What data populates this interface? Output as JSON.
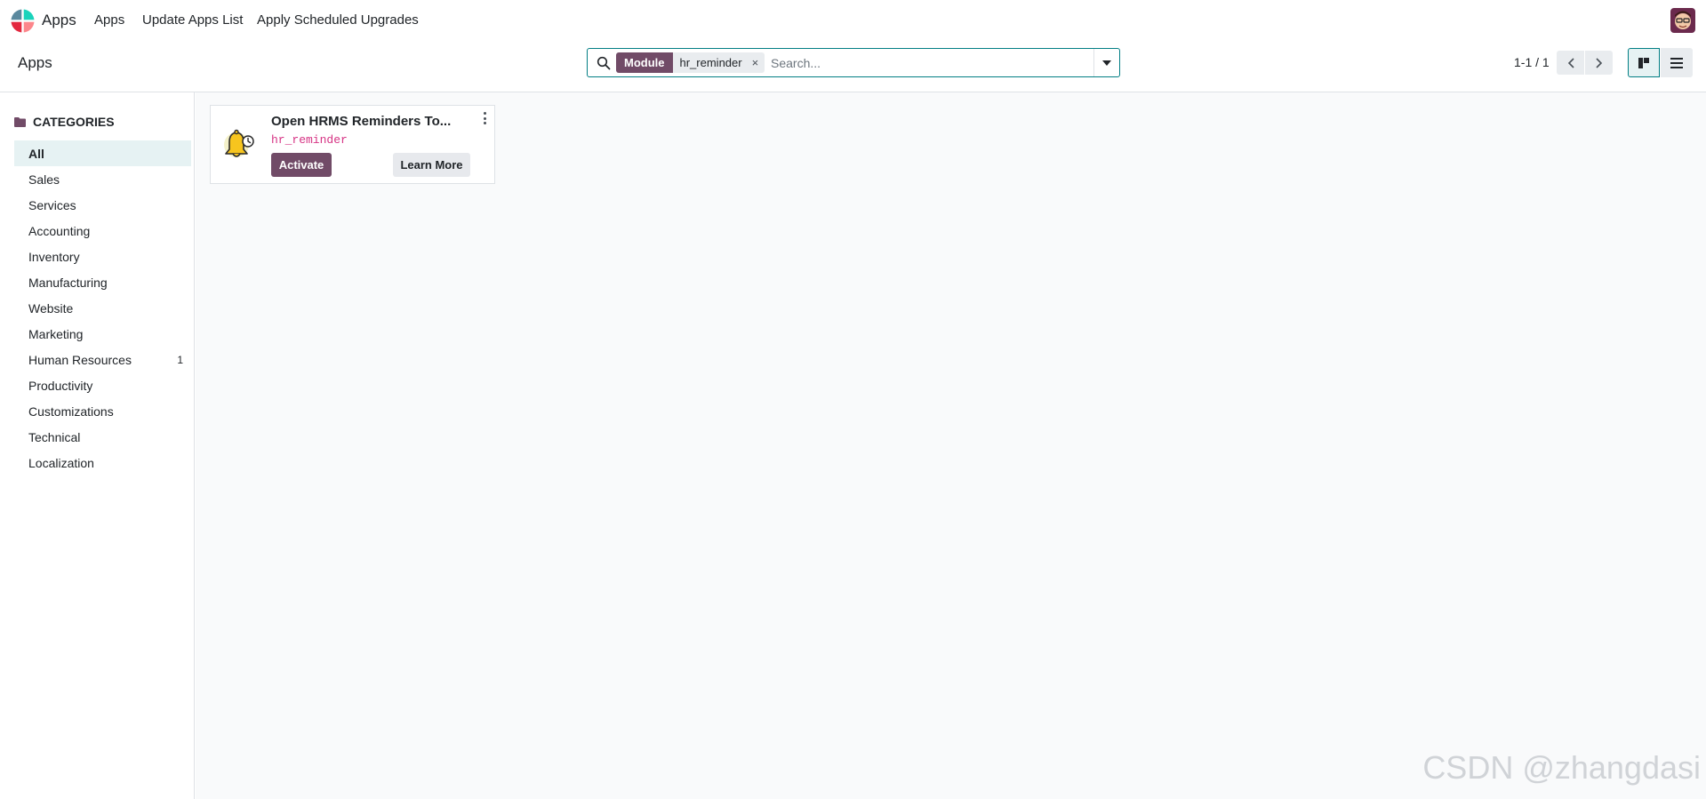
{
  "navbar": {
    "brand": "Apps",
    "menu": [
      "Apps",
      "Update Apps List",
      "Apply Scheduled Upgrades"
    ],
    "logo_icon": "odoo-apps-logo-icon",
    "avatar_icon": "user-avatar-icon"
  },
  "control_panel": {
    "breadcrumb": "Apps",
    "search": {
      "facet_label": "Module",
      "facet_value": "hr_reminder",
      "facet_remove": "×",
      "placeholder": "Search...",
      "value": ""
    },
    "pager": {
      "value": "1-1 / 1"
    },
    "views": [
      "kanban-view",
      "list-view"
    ]
  },
  "sidebar": {
    "header": "CATEGORIES",
    "items": [
      {
        "label": "All",
        "count": "",
        "active": true
      },
      {
        "label": "Sales",
        "count": ""
      },
      {
        "label": "Services",
        "count": ""
      },
      {
        "label": "Accounting",
        "count": ""
      },
      {
        "label": "Inventory",
        "count": ""
      },
      {
        "label": "Manufacturing",
        "count": ""
      },
      {
        "label": "Website",
        "count": ""
      },
      {
        "label": "Marketing",
        "count": ""
      },
      {
        "label": "Human Resources",
        "count": "1"
      },
      {
        "label": "Productivity",
        "count": ""
      },
      {
        "label": "Customizations",
        "count": ""
      },
      {
        "label": "Technical",
        "count": ""
      },
      {
        "label": "Localization",
        "count": ""
      }
    ]
  },
  "cards": [
    {
      "title": "Open HRMS Reminders To...",
      "technical_name": "hr_reminder",
      "activate_label": "Activate",
      "learn_more_label": "Learn More",
      "icon": "bell-icon"
    }
  ],
  "watermark": "CSDN @zhangdasi",
  "colors": {
    "primary": "#714b67",
    "accent": "#017e84",
    "tech_name": "#d63384",
    "active_category_bg": "#e6f2f3"
  }
}
